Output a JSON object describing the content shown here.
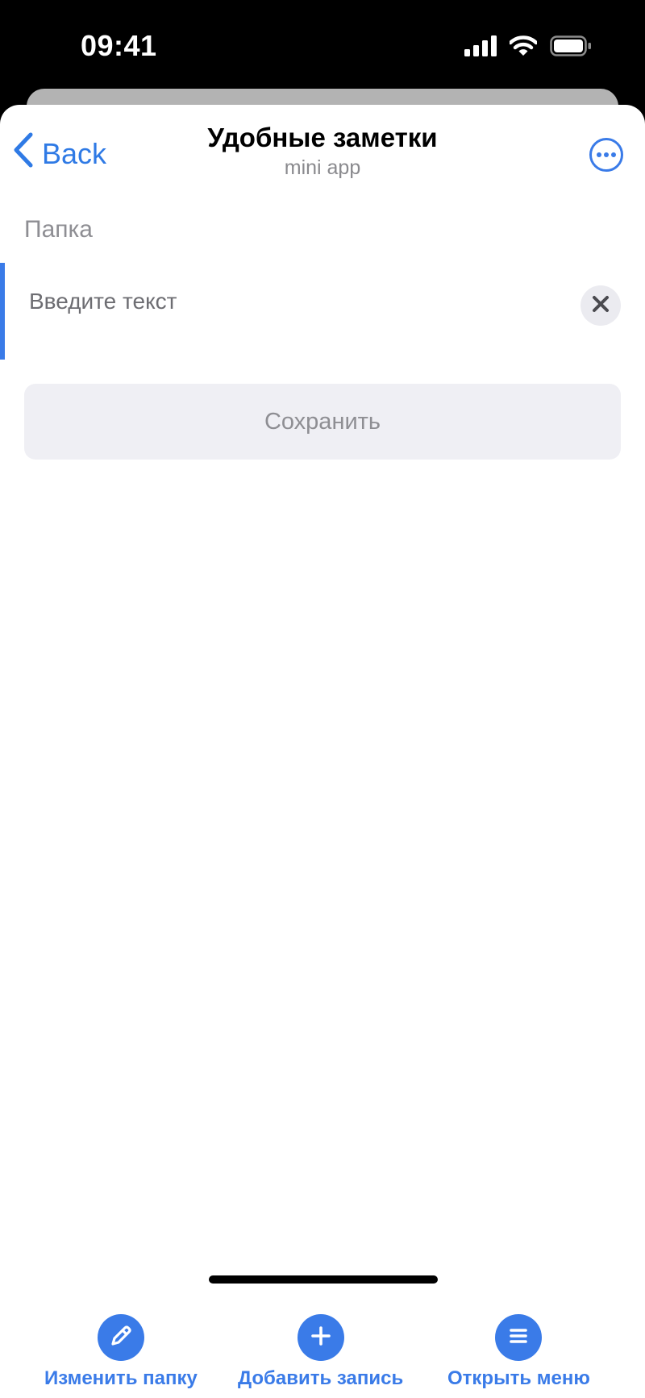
{
  "status_bar": {
    "time": "09:41",
    "icons": [
      "cellular-signal-icon",
      "wifi-icon",
      "battery-icon"
    ]
  },
  "nav": {
    "back_label": "Back",
    "title": "Удобные заметки",
    "subtitle": "mini app",
    "more_icon": "more-horizontal-icon"
  },
  "form": {
    "section_label": "Папка",
    "input_value": "",
    "input_placeholder": "Введите текст",
    "clear_icon": "close-icon",
    "save_label": "Сохранить"
  },
  "bottom_bar": {
    "actions": [
      {
        "label": "Изменить папку",
        "icon": "pencil-icon"
      },
      {
        "label": "Добавить запись",
        "icon": "plus-icon"
      },
      {
        "label": "Открыть меню",
        "icon": "menu-icon"
      }
    ]
  },
  "colors": {
    "accent": "#3a7be8",
    "back_link": "#2f7ae5",
    "muted_text": "#8e8e93",
    "button_fill": "#efeff4",
    "status_bar_bg": "#000000"
  }
}
